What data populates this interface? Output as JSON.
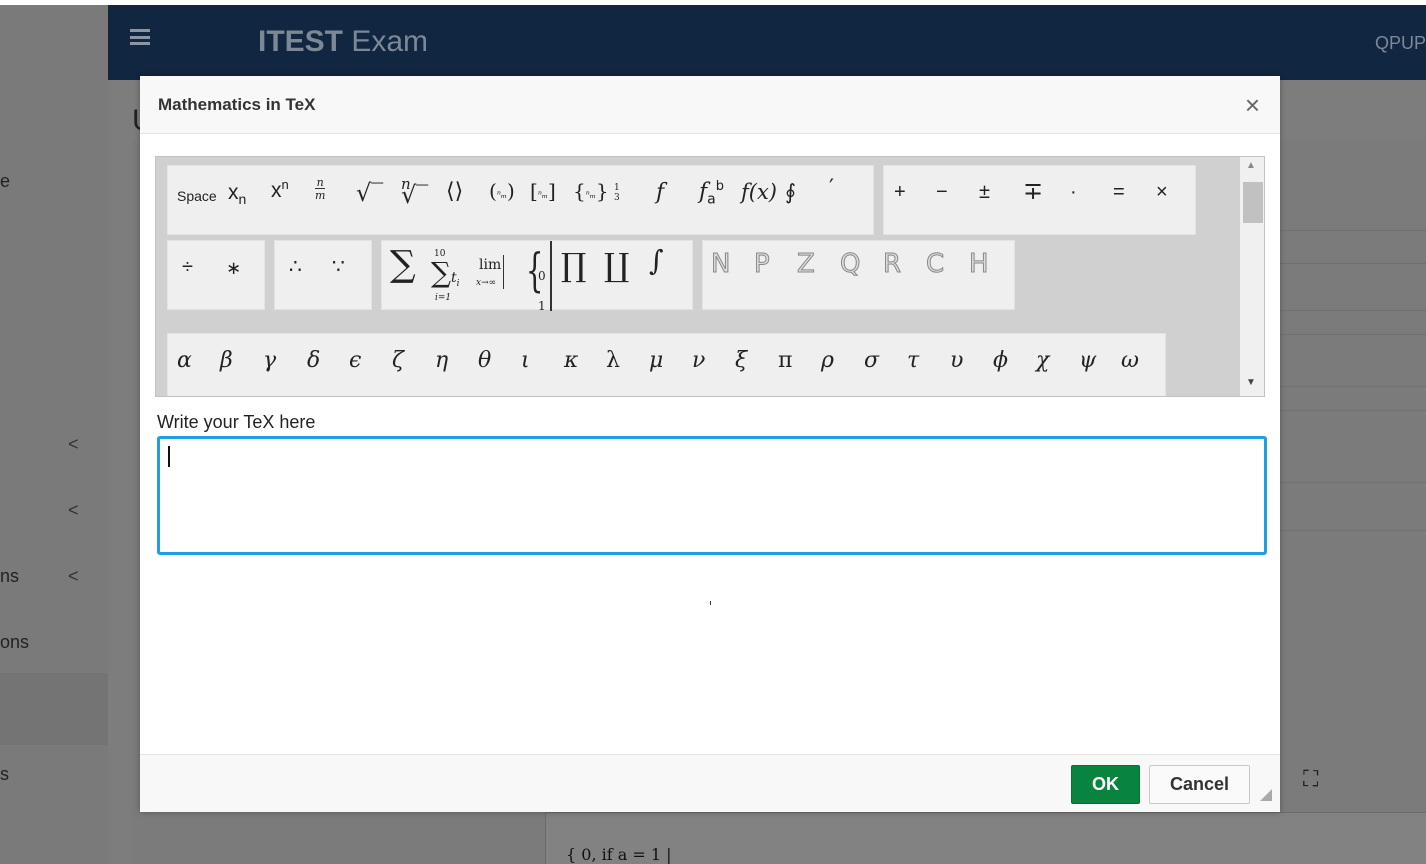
{
  "app": {
    "brand_bold": "ITEST",
    "brand_light": "Exam",
    "user": "QPUP"
  },
  "sidebar": {
    "items": [
      {
        "label": "e"
      },
      {
        "label": ""
      },
      {
        "label": ""
      },
      {
        "label": "ns"
      },
      {
        "label": "ons"
      },
      {
        "label": "s"
      }
    ]
  },
  "content": {
    "title_fragment": "U",
    "preview_tex": "{ 0,  if a = 1  |"
  },
  "dialog": {
    "title": "Mathematics in TeX",
    "close_symbol": "×",
    "tex_label": "Write your TeX here",
    "tex_value": "",
    "ok_label": "OK",
    "cancel_label": "Cancel"
  },
  "palette": {
    "space_label": "Space",
    "operators": [
      "+",
      "−",
      "±",
      "∓",
      "·",
      "=",
      "×"
    ],
    "division": [
      "÷",
      "∗"
    ],
    "logic": [
      "∴",
      "∵"
    ],
    "sets": [
      "N",
      "P",
      "Z",
      "Q",
      "R",
      "C",
      "H"
    ],
    "greek": [
      "α",
      "β",
      "γ",
      "δ",
      "ϵ",
      "ζ",
      "η",
      "θ",
      "ι",
      "κ",
      "λ",
      "μ",
      "ν",
      "ξ",
      "π",
      "ρ",
      "σ",
      "τ",
      "υ",
      "ϕ",
      "χ",
      "ψ",
      "ω"
    ],
    "sum_top": "10",
    "sum_bottom": "i=1",
    "lim_label": "lim",
    "lim_sub": "x→∞"
  },
  "colors": {
    "accent": "#1f9ee0",
    "ok": "#09843f",
    "header": "#112641"
  }
}
